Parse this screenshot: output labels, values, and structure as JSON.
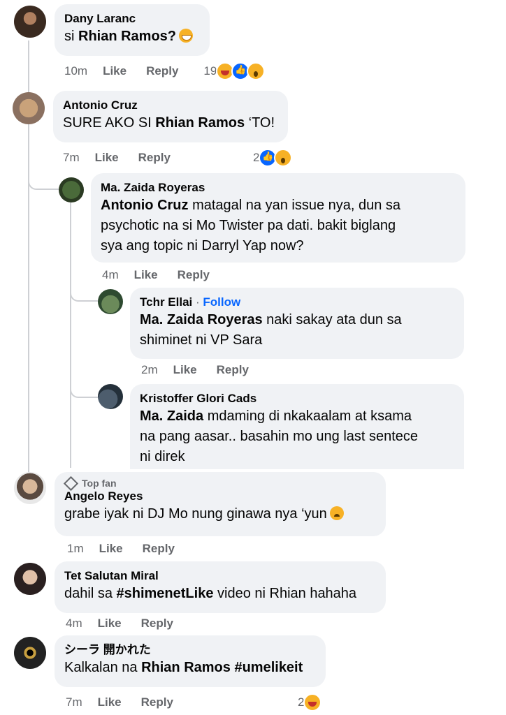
{
  "comments": [
    {
      "author": "Dany Laranc",
      "text_pre": "si ",
      "text_bold": "Rhian Ramos?",
      "text_post": "",
      "time": "10m",
      "like": "Like",
      "reply": "Reply",
      "reaction_count": "19",
      "reactions": [
        "haha-icon",
        "like-icon",
        "wow-icon"
      ]
    },
    {
      "author": "Antonio Cruz",
      "text_pre": "SURE AKO SI ",
      "text_bold": "Rhian Ramos",
      "text_post": " ‘TO!",
      "time": "7m",
      "like": "Like",
      "reply": "Reply",
      "reaction_count": "2",
      "reactions": [
        "like-icon",
        "wow-icon"
      ]
    },
    {
      "author": "Ma. Zaida Royeras",
      "mention": "Antonio Cruz",
      "text_line1": " matagal na yan issue nya, dun sa",
      "text_line2": "psychotic na si Mo Twister pa dati. bakit biglang",
      "text_line3": "sya ang topic ni Darryl Yap now?",
      "time": "4m",
      "like": "Like",
      "reply": "Reply"
    },
    {
      "author": "Tchr Ellai",
      "separator": " · ",
      "follow": "Follow",
      "mention": "Ma. Zaida Royeras",
      "text_line1": " naki sakay ata dun sa",
      "text_line2": "shiminet ni VP Sara",
      "time": "2m",
      "like": "Like",
      "reply": "Reply"
    },
    {
      "author": "Kristoffer Glori Cads",
      "mention": "Ma. Zaida",
      "text_line1": " mdaming di nkakaalam at ksama",
      "text_line2": "na pang aasar.. basahin mo ung last sentece",
      "text_line3": "ni direk"
    },
    {
      "badge": "Top fan",
      "author": "Angelo Reyes",
      "text": "grabe iyak ni DJ Mo nung ginawa nya ‘yun",
      "time": "1m",
      "like": "Like",
      "reply": "Reply"
    },
    {
      "author": "Tet Salutan Miral",
      "text_pre": "dahil sa ",
      "text_bold": "#shimenetLike",
      "text_post": " video ni Rhian hahaha",
      "time": "4m",
      "like": "Like",
      "reply": "Reply"
    },
    {
      "author": "シーラ 開かれた",
      "text_pre": "Kalkalan na ",
      "text_bold": "Rhian Ramos",
      "text_mid": " ",
      "text_bold2": "#umelikeit",
      "time": "7m",
      "like": "Like",
      "reply": "Reply",
      "reaction_count": "2",
      "reactions": [
        "haha-icon"
      ]
    }
  ],
  "colors": {
    "bubble": "#f0f2f5",
    "meta": "#65676b",
    "follow": "#0866ff",
    "thread_line": "#ced0d4"
  }
}
